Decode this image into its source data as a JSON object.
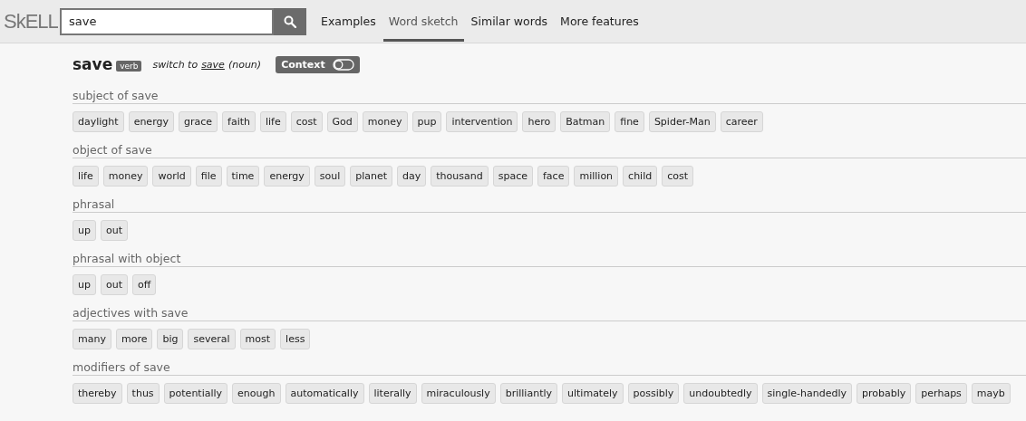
{
  "logo": "SkELL",
  "search": {
    "value": "save"
  },
  "nav": [
    {
      "label": "Examples",
      "selected": false
    },
    {
      "label": "Word sketch",
      "selected": true
    },
    {
      "label": "Similar words",
      "selected": false
    },
    {
      "label": "More features",
      "selected": false
    }
  ],
  "headword": {
    "word": "save",
    "pos": "verb",
    "switch_prefix": "switch to",
    "switch_word": "save",
    "switch_suffix": "(noun)",
    "context": {
      "label": "Context",
      "on": false
    }
  },
  "sections": [
    {
      "title": "subject of save",
      "words": [
        "daylight",
        "energy",
        "grace",
        "faith",
        "life",
        "cost",
        "God",
        "money",
        "pup",
        "intervention",
        "hero",
        "Batman",
        "fine",
        "Spider-Man",
        "career"
      ]
    },
    {
      "title": "object of save",
      "words": [
        "life",
        "money",
        "world",
        "file",
        "time",
        "energy",
        "soul",
        "planet",
        "day",
        "thousand",
        "space",
        "face",
        "million",
        "child",
        "cost"
      ]
    },
    {
      "title": "phrasal",
      "words": [
        "up",
        "out"
      ]
    },
    {
      "title": "phrasal with object",
      "words": [
        "up",
        "out",
        "off"
      ]
    },
    {
      "title": "adjectives with save",
      "words": [
        "many",
        "more",
        "big",
        "several",
        "most",
        "less"
      ]
    },
    {
      "title": "modifiers of save",
      "words": [
        "thereby",
        "thus",
        "potentially",
        "enough",
        "automatically",
        "literally",
        "miraculously",
        "brilliantly",
        "ultimately",
        "possibly",
        "undoubtedly",
        "single-handedly",
        "probably",
        "perhaps",
        "mayb"
      ]
    }
  ]
}
